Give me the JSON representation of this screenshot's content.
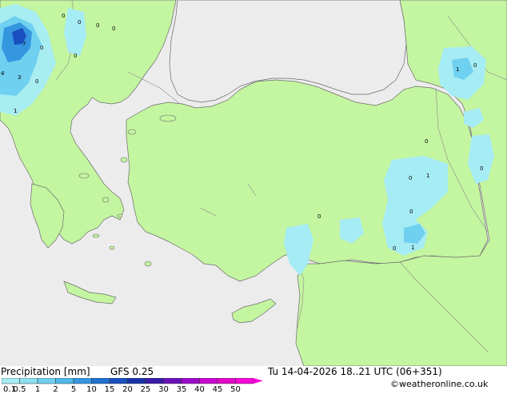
{
  "map": {
    "land_color": "#c4f5a0",
    "sea_color": "#ececec",
    "precip_labels": [
      "0",
      "0",
      "0",
      "0",
      "7",
      "0",
      "4",
      "3",
      "0",
      "1",
      "0",
      "1",
      "0",
      "0",
      "0",
      "1",
      "0",
      "0",
      "0",
      "1",
      "0"
    ]
  },
  "footer": {
    "left_title": "Precipitation [mm]",
    "model": "GFS 0.25",
    "datetime": "Tu 14-04-2026 18..21 UTC (06+351)",
    "credit": "©weatheronline.co.uk"
  },
  "legend": {
    "ticks": [
      "0.1",
      "0.5",
      "1",
      "2",
      "5",
      "10",
      "15",
      "20",
      "25",
      "30",
      "35",
      "40",
      "45",
      "50"
    ],
    "colors": [
      "#a6ecf5",
      "#8ee0f0",
      "#6fd0f0",
      "#4fb8ea",
      "#3596e0",
      "#2070d0",
      "#1a4fc0",
      "#1a32a8",
      "#3a1aa8",
      "#6a12b8",
      "#9a0ac8",
      "#c808d0",
      "#e406c8",
      "#f604d8"
    ]
  }
}
